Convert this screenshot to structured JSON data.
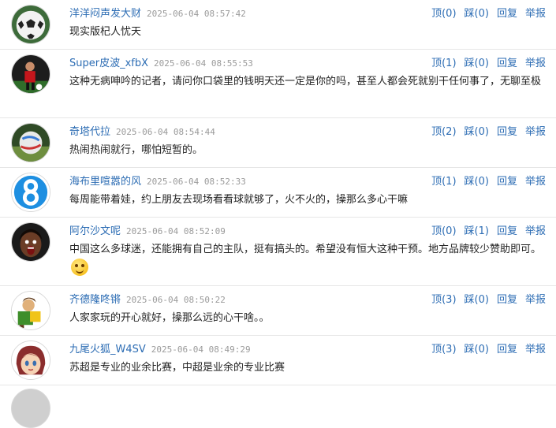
{
  "action_labels": {
    "up": "顶",
    "down": "踩",
    "reply": "回复",
    "report": "举报"
  },
  "comments": [
    {
      "user": "洋洋闷声发大财",
      "time": "2025-06-04 08:57:42",
      "up": "(0)",
      "down": "(0)",
      "text": "现实版杞人忧天"
    },
    {
      "user": "Super皮波_xfbX",
      "time": "2025-06-04 08:55:53",
      "up": "(1)",
      "down": "(0)",
      "text": "这种无病呻吟的记者，请问你口袋里的钱明天还一定是你的吗，甚至人都会死就别干任何事了，无聊至极"
    },
    {
      "user": "奇塔代拉",
      "time": "2025-06-04 08:54:44",
      "up": "(2)",
      "down": "(0)",
      "text": "热闹热闹就行，哪怕短暂的。"
    },
    {
      "user": "海布里喧嚣的风",
      "time": "2025-06-04 08:52:33",
      "up": "(1)",
      "down": "(0)",
      "text": "每周能带着娃，约上朋友去现场看看球就够了，火不火的，操那么多心干嘛"
    },
    {
      "user": "阿尔沙文呢",
      "time": "2025-06-04 08:52:09",
      "up": "(0)",
      "down": "(1)",
      "text": "中国这么多球迷，还能拥有自己的主队，挺有搞头的。希望没有恒大这种干预。地方品牌较少赞助即可。"
    },
    {
      "user": "齐德隆咚锵",
      "time": "2025-06-04 08:50:22",
      "up": "(3)",
      "down": "(0)",
      "text": "人家家玩的开心就好，操那么远的心干啥。。"
    },
    {
      "user": "九尾火狐_W4SV",
      "time": "2025-06-04 08:49:29",
      "up": "(3)",
      "down": "(0)",
      "text": "苏超是专业的业余比赛，中超是业余的专业比赛"
    }
  ]
}
